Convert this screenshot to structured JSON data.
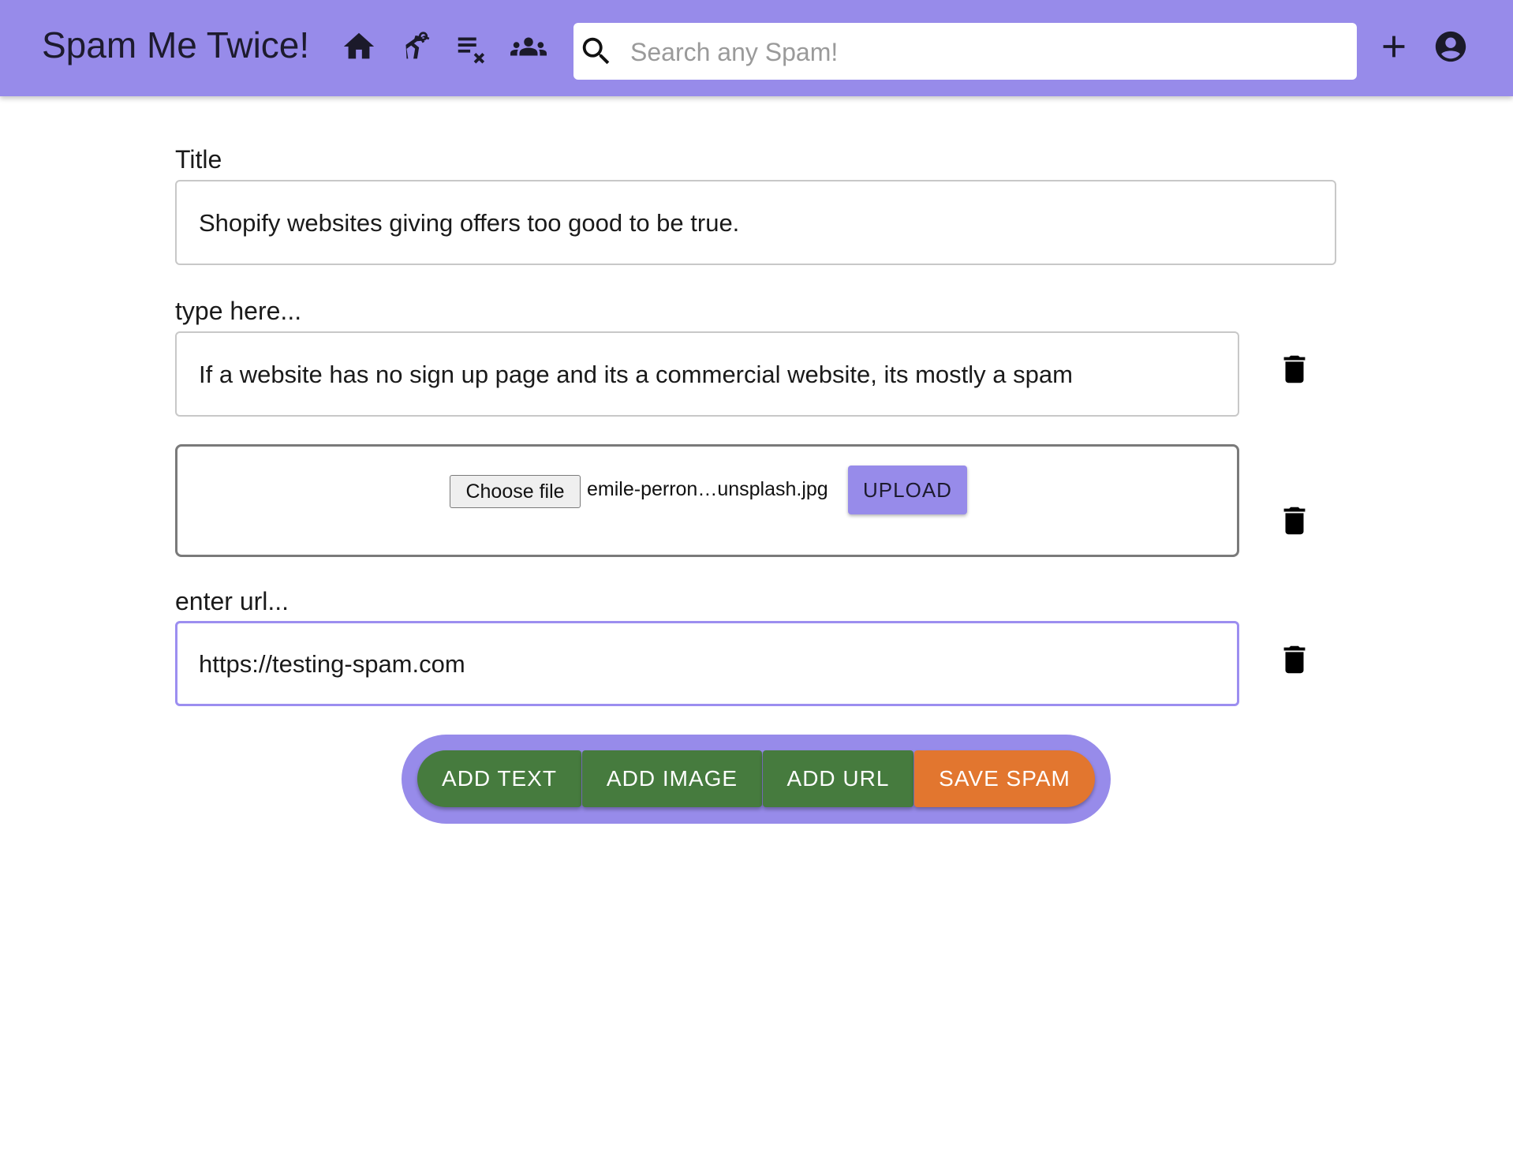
{
  "app": {
    "title": "Spam Me Twice!"
  },
  "nav": {
    "icons": [
      "home-icon",
      "robot-arm-icon",
      "clear-list-icon",
      "groups-icon"
    ],
    "right_icons": [
      "add-icon",
      "account-circle-icon"
    ]
  },
  "search": {
    "placeholder": "Search any Spam!",
    "value": ""
  },
  "form": {
    "title_label": "Title",
    "title_value": "Shopify websites giving offers too good to be true.",
    "text_label": "type here...",
    "text_value": "If a website has no sign up page and its a commercial website, its mostly a spam",
    "file": {
      "choose_label": "Choose file",
      "file_name": "emile-perron…unsplash.jpg",
      "upload_label": "UPLOAD"
    },
    "url_label": "enter url...",
    "url_value": "https://testing-spam.com"
  },
  "actions": {
    "add_text": "ADD TEXT",
    "add_image": "ADD IMAGE",
    "add_url": "ADD URL",
    "save": "SAVE SPAM"
  },
  "colors": {
    "appbar": "#978bea",
    "green_button": "#467b3e",
    "orange_button": "#e2762f",
    "focus_border": "#9c8ef0"
  }
}
